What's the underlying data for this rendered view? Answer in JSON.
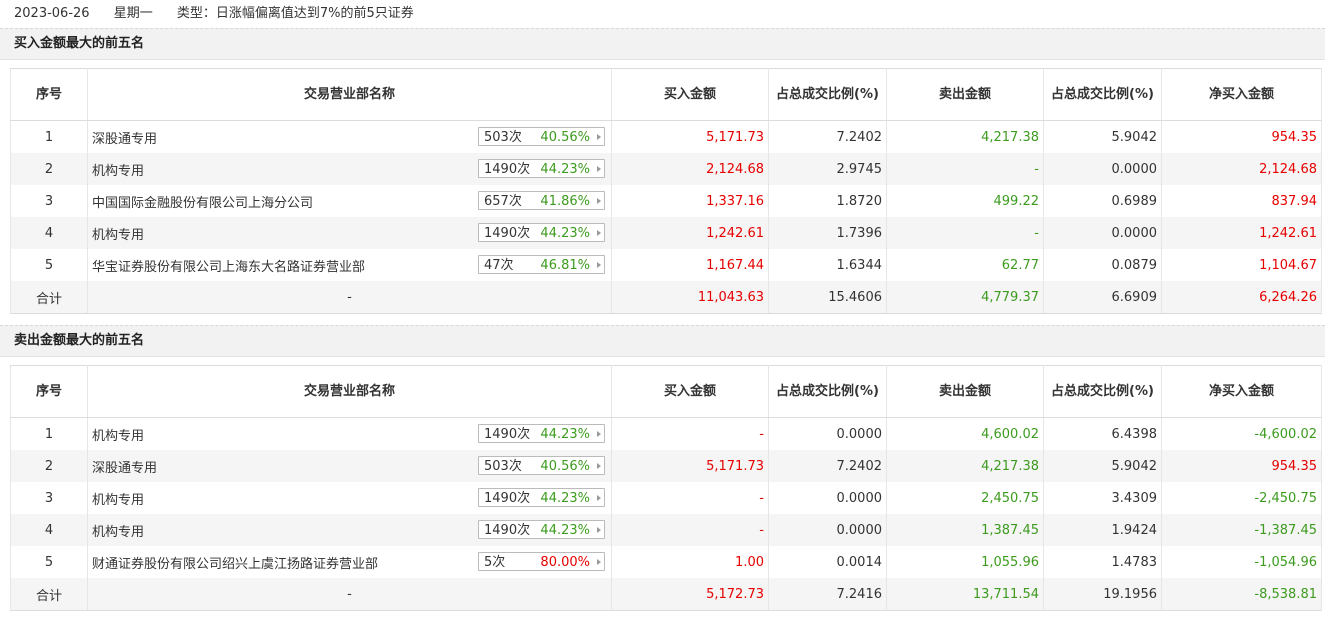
{
  "header": {
    "date": "2023-06-26",
    "weekday": "星期一",
    "type_label": "类型：日涨幅偏离值达到7%的前5只证券"
  },
  "columns": [
    "序号",
    "交易营业部名称",
    "买入金额",
    "占总成交比例(%)",
    "卖出金额",
    "占总成交比例(%)",
    "净买入金额"
  ],
  "sections": [
    {
      "title": "买入金额最大的前五名",
      "rows": [
        {
          "no": "1",
          "name": "深股通专用",
          "times": "503次",
          "rate": "40.56%",
          "rate_color": "green",
          "buy": "5,171.73",
          "buy_pct": "7.2402",
          "sell": "4,217.38",
          "sell_pct": "5.9042",
          "net": "954.35",
          "net_color": "red"
        },
        {
          "no": "2",
          "name": "机构专用",
          "times": "1490次",
          "rate": "44.23%",
          "rate_color": "green",
          "buy": "2,124.68",
          "buy_pct": "2.9745",
          "sell": "-",
          "sell_pct": "0.0000",
          "net": "2,124.68",
          "net_color": "red"
        },
        {
          "no": "3",
          "name": "中国国际金融股份有限公司上海分公司",
          "times": "657次",
          "rate": "41.86%",
          "rate_color": "green",
          "buy": "1,337.16",
          "buy_pct": "1.8720",
          "sell": "499.22",
          "sell_pct": "0.6989",
          "net": "837.94",
          "net_color": "red"
        },
        {
          "no": "4",
          "name": "机构专用",
          "times": "1490次",
          "rate": "44.23%",
          "rate_color": "green",
          "buy": "1,242.61",
          "buy_pct": "1.7396",
          "sell": "-",
          "sell_pct": "0.0000",
          "net": "1,242.61",
          "net_color": "red"
        },
        {
          "no": "5",
          "name": "华宝证券股份有限公司上海东大名路证券营业部",
          "times": "47次",
          "rate": "46.81%",
          "rate_color": "green",
          "buy": "1,167.44",
          "buy_pct": "1.6344",
          "sell": "62.77",
          "sell_pct": "0.0879",
          "net": "1,104.67",
          "net_color": "red"
        }
      ],
      "total": {
        "label": "合计",
        "name": "-",
        "buy": "11,043.63",
        "buy_pct": "15.4606",
        "sell": "4,779.37",
        "sell_pct": "6.6909",
        "net": "6,264.26",
        "net_color": "red"
      }
    },
    {
      "title": "卖出金额最大的前五名",
      "rows": [
        {
          "no": "1",
          "name": "机构专用",
          "times": "1490次",
          "rate": "44.23%",
          "rate_color": "green",
          "buy": "-",
          "buy_pct": "0.0000",
          "sell": "4,600.02",
          "sell_pct": "6.4398",
          "net": "-4,600.02",
          "net_color": "green"
        },
        {
          "no": "2",
          "name": "深股通专用",
          "times": "503次",
          "rate": "40.56%",
          "rate_color": "green",
          "buy": "5,171.73",
          "buy_pct": "7.2402",
          "sell": "4,217.38",
          "sell_pct": "5.9042",
          "net": "954.35",
          "net_color": "red"
        },
        {
          "no": "3",
          "name": "机构专用",
          "times": "1490次",
          "rate": "44.23%",
          "rate_color": "green",
          "buy": "-",
          "buy_pct": "0.0000",
          "sell": "2,450.75",
          "sell_pct": "3.4309",
          "net": "-2,450.75",
          "net_color": "green"
        },
        {
          "no": "4",
          "name": "机构专用",
          "times": "1490次",
          "rate": "44.23%",
          "rate_color": "green",
          "buy": "-",
          "buy_pct": "0.0000",
          "sell": "1,387.45",
          "sell_pct": "1.9424",
          "net": "-1,387.45",
          "net_color": "green"
        },
        {
          "no": "5",
          "name": "财通证券股份有限公司绍兴上虞江扬路证券营业部",
          "times": "5次",
          "rate": "80.00%",
          "rate_color": "red",
          "buy": "1.00",
          "buy_pct": "0.0014",
          "sell": "1,055.96",
          "sell_pct": "1.4783",
          "net": "-1,054.96",
          "net_color": "green"
        }
      ],
      "total": {
        "label": "合计",
        "name": "-",
        "buy": "5,172.73",
        "buy_pct": "7.2416",
        "sell": "13,711.54",
        "sell_pct": "19.1956",
        "net": "-8,538.81",
        "net_color": "green"
      }
    }
  ],
  "colors": {
    "up": "#e60000",
    "down": "#3c9b1e"
  }
}
